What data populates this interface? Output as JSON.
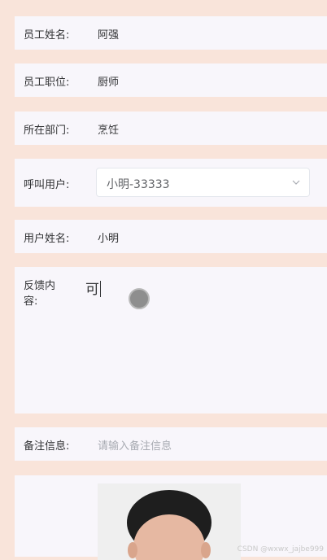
{
  "form": {
    "employee_name": {
      "label": "员工姓名:",
      "value": "阿强"
    },
    "employee_position": {
      "label": "员工职位:",
      "value": "厨师"
    },
    "department": {
      "label": "所在部门:",
      "value": "烹饪"
    },
    "call_user": {
      "label": "呼叫用户:",
      "value": "小明-33333"
    },
    "user_name": {
      "label": "用户姓名:",
      "value": "小明"
    },
    "feedback": {
      "label": "反馈内容:",
      "value": "可"
    },
    "remark": {
      "label": "备注信息:",
      "placeholder": "请输入备注信息"
    }
  },
  "watermark": "CSDN @wxwx_jajbe999",
  "icons": {
    "select_arrow": "chevron-down-icon",
    "photo": "person-photo"
  },
  "colors": {
    "page_background": "#f9e4da",
    "card_background": "#f8f6fb",
    "touch_indicator": "#8e8e8e"
  }
}
